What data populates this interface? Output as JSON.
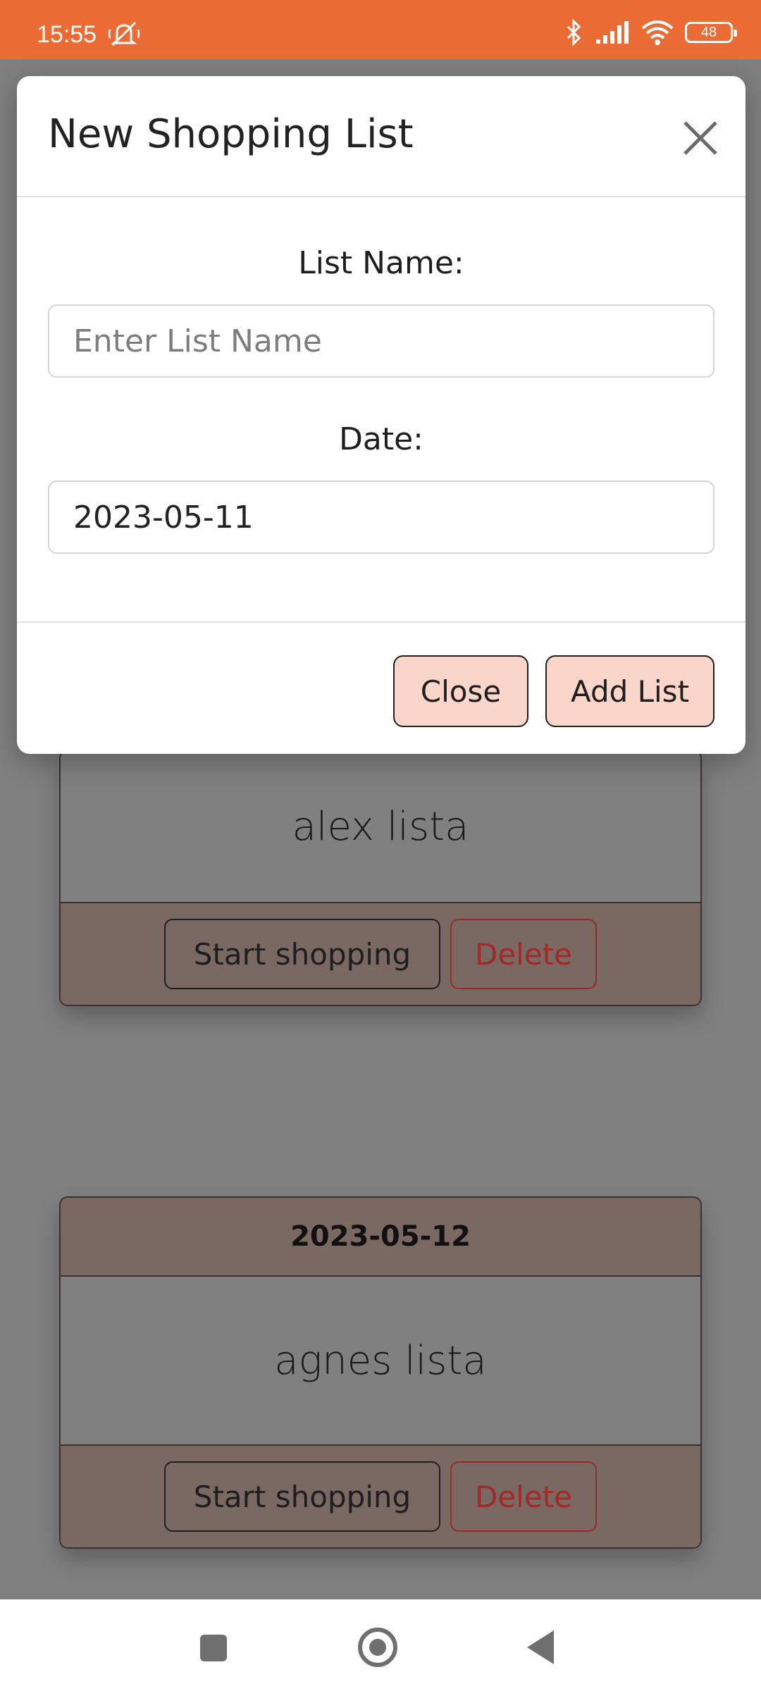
{
  "status_bar": {
    "time": "15:55",
    "battery": "48",
    "accent_color": "#eb6b35"
  },
  "modal": {
    "title": "New Shopping List",
    "list_name_label": "List Name:",
    "list_name_placeholder": "Enter List Name",
    "list_name_value": "",
    "date_label": "Date:",
    "date_value": "2023-05-11",
    "close_button": "Close",
    "add_button": "Add List",
    "button_color": "#f9d6c9"
  },
  "lists": [
    {
      "name": "alex lista",
      "start_label": "Start shopping",
      "delete_label": "Delete"
    },
    {
      "date": "2023-05-12",
      "name": "agnes lista",
      "start_label": "Start shopping",
      "delete_label": "Delete"
    }
  ],
  "icons": {
    "close": "close-icon",
    "mute": "mute-icon",
    "bluetooth": "bluetooth-icon",
    "signal": "signal-icon",
    "wifi": "wifi-icon",
    "battery": "battery-icon",
    "recents": "recents-icon",
    "home": "home-icon",
    "back": "back-icon"
  }
}
